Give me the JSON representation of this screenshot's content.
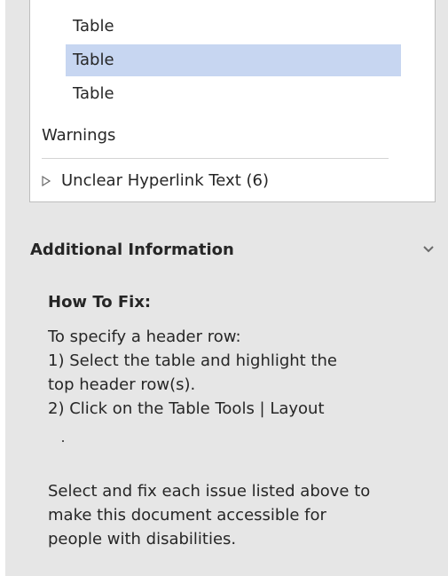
{
  "results": {
    "table_items": [
      "Table",
      "Table",
      "Table"
    ],
    "selected_index": 1,
    "warnings_label": "Warnings",
    "warning_item": "Unclear Hyperlink Text (6)"
  },
  "additional_info": {
    "title": "Additional Information",
    "chevron_icon": "chevron-down-icon",
    "how_to_fix_title": "How To Fix:",
    "how_to_fix_lines": [
      "To specify a header row:",
      "1) Select the table and highlight the",
      "top header row(s).",
      "2) Click on the Table Tools | Layout"
    ],
    "footer_lines": [
      "Select and fix each issue listed above to",
      "make this document accessible for",
      "people with disabilities."
    ]
  },
  "colors": {
    "pane_background": "#e6e6e6",
    "selection": "#c7d6f1",
    "text": "#262626"
  }
}
